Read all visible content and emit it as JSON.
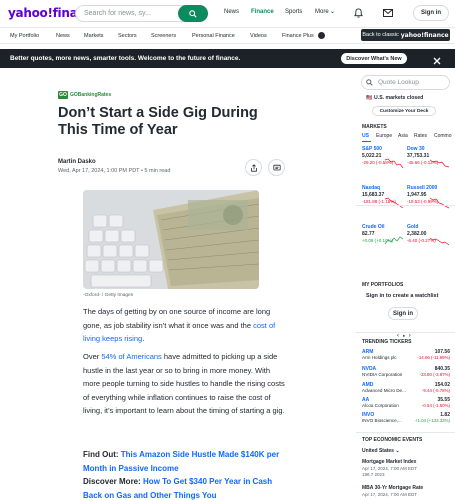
{
  "header": {
    "logo": "yahoo!finance",
    "search_placeholder": "Search for news, sy...",
    "nav": [
      "News",
      "Finance",
      "Sports",
      "More"
    ],
    "signin": "Sign in"
  },
  "subnav": {
    "items": [
      "My Portfolio",
      "News",
      "Markets",
      "Sectors",
      "Screeners",
      "Personal Finance",
      "Videos",
      "Finance Plus"
    ],
    "back_label": "Back to classic",
    "back_brand": "yahoo!finance"
  },
  "banner": {
    "message": "Better quotes, more news, smarter tools. Welcome to the future of finance.",
    "cta": "Discover What's New"
  },
  "article": {
    "source": "GOBankingRates",
    "source_mark": "GO",
    "headline": "Don’t Start a Side Gig During This Time of Year",
    "author": "Martin Dasko",
    "meta": "Wed, Apr 17, 2024, 1:00 PM PDT • 5 min read",
    "caption": "-Oxford- / Getty Images",
    "p1_a": "The days of getting by on one source of income are long gone, as job stability isn’t what it once was and the ",
    "p1_link": "cost of living keeps rising",
    "p1_b": ".",
    "p2_a": "Over ",
    "p2_link": "54% of Americans",
    "p2_b": " have admitted to picking up a side hustle in the last year or so to bring in more money. With more people turning to side hustles to handle the rising costs of everything while inflation continues to raise the cost of living, it’s important to learn about the timing of starting a gig.",
    "find_out_label": "Find Out: ",
    "find_out_link": "This Amazon Side Hustle Made $140K per Month in Passive Income",
    "discover_label": "Discover More: ",
    "discover_link": "How To Get $340 Per Year in Cash Back on Gas and Other Things You"
  },
  "rail": {
    "quote_placeholder": "Quote Lookup",
    "market_status": "U.S. markets closed",
    "customize": "Customize Your Deck",
    "markets_title": "MARKETS",
    "tabs": [
      "US",
      "Europe",
      "Asia",
      "Rates",
      "Commo"
    ],
    "markets": [
      {
        "name": "S&P 500",
        "value": "5,022.21",
        "change": "-29.20 (-0.58%)",
        "dir": "neg"
      },
      {
        "name": "Dow 30",
        "value": "37,753.31",
        "change": "-45.66 (-0.12%)",
        "dir": "neg"
      },
      {
        "name": "Nasdaq",
        "value": "15,683.37",
        "change": "-181.88 (-1.15%)",
        "dir": "neg"
      },
      {
        "name": "Russell 2000",
        "value": "1,947.95",
        "change": "-19.53 (-0.99%)",
        "dir": "neg"
      },
      {
        "name": "Crude Oil",
        "value": "82.77",
        "change": "+0.08 (+0.10%)",
        "dir": "pos"
      },
      {
        "name": "Gold",
        "value": "2,382.00",
        "change": "-6.40 (-0.27%)",
        "dir": "neg"
      }
    ],
    "portfolio_title": "MY PORTFOLIOS",
    "portfolio_msg": "Sign in to create a watchlist",
    "portfolio_btn": "Sign in",
    "trending_title": "TRENDING TICKERS",
    "tickers": [
      {
        "sym": "ARM",
        "name": "Arm Holdings plc",
        "price": "107.56",
        "change": "-14.66 (-11.99%)",
        "dir": "neg"
      },
      {
        "sym": "NVDA",
        "name": "NVIDIA Corporation",
        "price": "840.35",
        "change": "-33.80 (-3.87%)",
        "dir": "neg"
      },
      {
        "sym": "AMD",
        "name": "Advanced Micro De...",
        "price": "154.02",
        "change": "-9.44 (-5.78%)",
        "dir": "neg"
      },
      {
        "sym": "AA",
        "name": "Alcoa Corporation",
        "price": "35.55",
        "change": "-0.54 (-1.50%)",
        "dir": "neg"
      },
      {
        "sym": "INVO",
        "name": "INVO Bioscience,...",
        "price": "1.82",
        "change": "+1.04 (+133.33%)",
        "dir": "pos"
      }
    ],
    "events_title": "TOP ECONOMIC EVENTS",
    "events_country": "United States",
    "events": [
      {
        "title": "Mortgage Market Index",
        "date": "Apr 17, 2024, 7:00 AM EDT",
        "stats": "198.7     2023"
      },
      {
        "title": "MBA 30-Yr Mortgage Rate",
        "date": "Apr 17, 2024, 7:00 AM EDT",
        "stats": "7.01     7.13"
      }
    ]
  },
  "colors": {
    "brand": "#6001d2",
    "accent": "#0f8a5f",
    "link": "#0f69ff",
    "neg": "#eb0f29",
    "pos": "#21a150"
  }
}
